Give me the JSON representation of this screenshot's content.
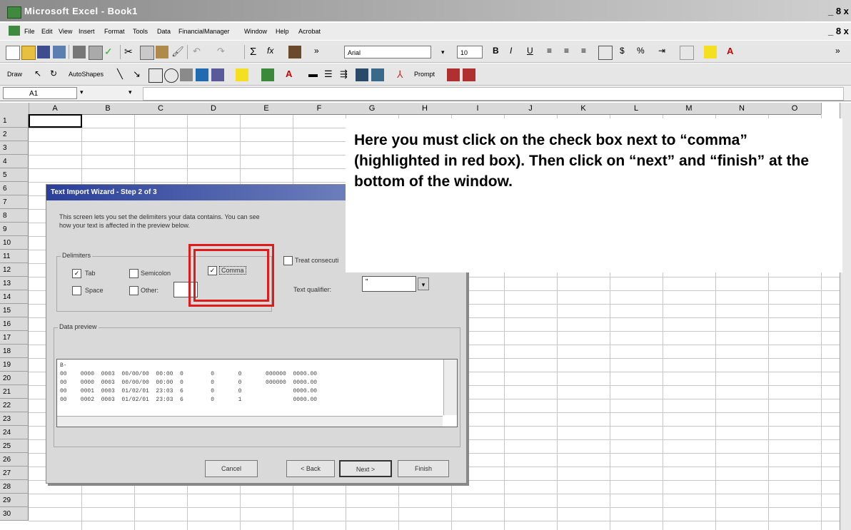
{
  "window": {
    "title": "Microsoft Excel - Book1",
    "controls": "_ 8 x"
  },
  "menu": [
    "File",
    "Edit",
    "View",
    "Insert",
    "Format",
    "Tools",
    "Data",
    "FinancialManager",
    "Window",
    "Help",
    "Acrobat"
  ],
  "toolbar": {
    "font_name": "Arial",
    "font_size": "10",
    "draw_label": "Draw",
    "autoshapes_label": "AutoShapes",
    "prompt_label": "Prompt"
  },
  "formula_bar": {
    "name_box": "A1"
  },
  "columns": [
    "A",
    "B",
    "C",
    "D",
    "E",
    "F",
    "G",
    "H",
    "I",
    "J",
    "K",
    "L",
    "M",
    "N",
    "O"
  ],
  "rows": [
    "1",
    "2",
    "3",
    "4",
    "5",
    "6",
    "7",
    "8",
    "9",
    "10",
    "11",
    "12",
    "13",
    "14",
    "15",
    "16",
    "17",
    "18",
    "19",
    "20",
    "21",
    "22",
    "23",
    "24",
    "25",
    "26",
    "27",
    "28",
    "29",
    "30"
  ],
  "dialog": {
    "title": "Text Import Wizard - Step 2 of 3",
    "description_line1": "This screen lets you set the delimiters your data contains.  You can see",
    "description_line2": "how your text is affected in the preview below.",
    "delimiters_label": "Delimiters",
    "tab_label": "Tab",
    "semicolon_label": "Semicolon",
    "comma_label": "Comma",
    "space_label": "Space",
    "other_label": "Other:",
    "treat_label": "Treat consecuti",
    "qualifier_label": "Text qualifier:",
    "qualifier_value": "\"",
    "preview_label": "Data preview",
    "preview_lines": [
      "B-",
      "00    0000  0003  00/00/00  00:00  0        0       0       000000  0000.00",
      "00    0000  0003  00/00/00  00:00  0        0       0       000000  0000.00",
      "00    0001  0003  01/02/01  23:03  6        0       0               0000.00",
      "00    0002  0003  01/02/01  23:03  6        0       1               0000.00"
    ],
    "cancel_label": "Cancel",
    "back_label": "< Back",
    "next_label": "Next >",
    "finish_label": "Finish"
  },
  "callout": {
    "text": "Here you must click on the check box next to “comma” (highlighted in red box).  Then click on “next” and “finish” at the bottom of the window."
  },
  "colors": {
    "highlight": "#e01b1b",
    "dialog_title": "#2a3f9a"
  }
}
